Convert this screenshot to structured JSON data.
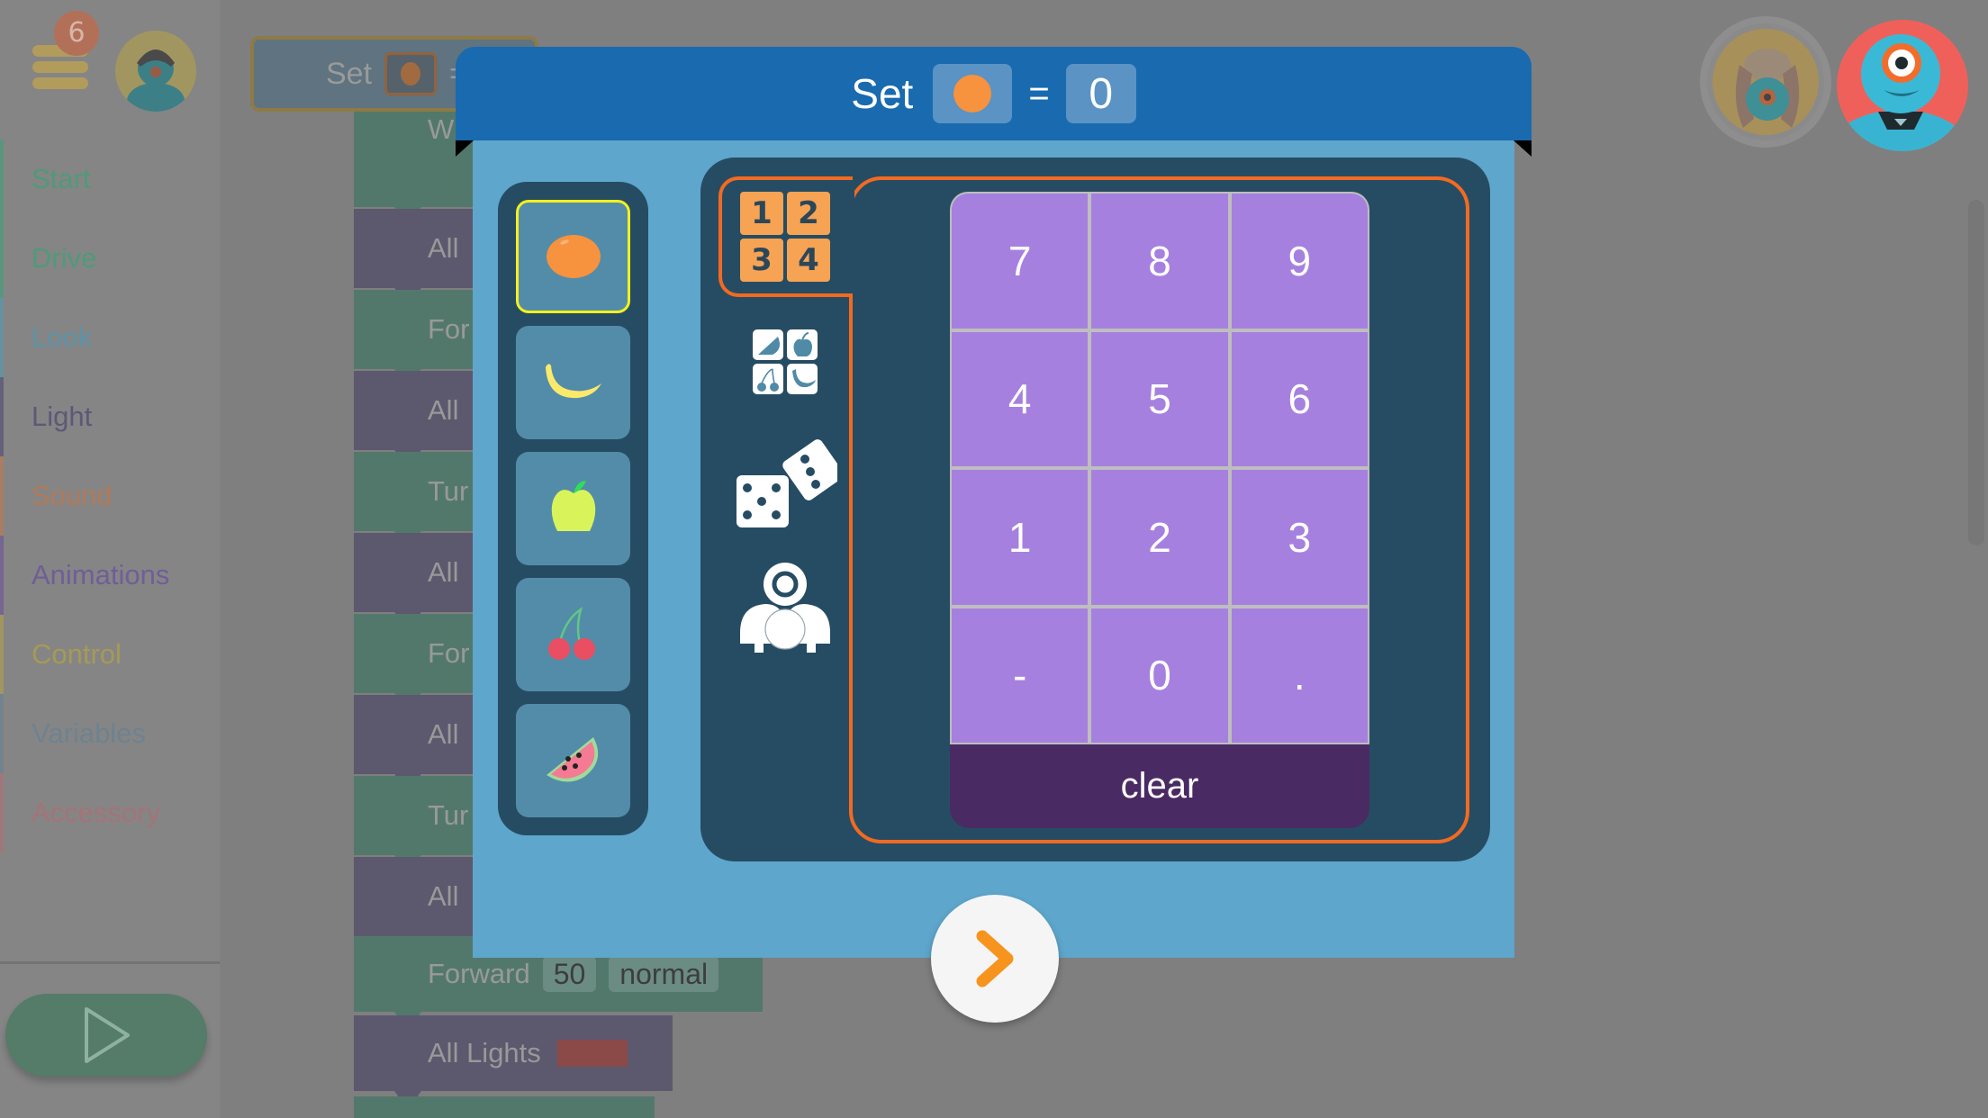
{
  "app": {
    "notification_count": "6",
    "sidebar": {
      "categories": [
        {
          "label": "Start",
          "color": "#4f9a7a"
        },
        {
          "label": "Drive",
          "color": "#4f9a7a"
        },
        {
          "label": "Look",
          "color": "#5d93a8"
        },
        {
          "label": "Light",
          "color": "#5d5877"
        },
        {
          "label": "Sound",
          "color": "#b07a5a"
        },
        {
          "label": "Animations",
          "color": "#705e96"
        },
        {
          "label": "Control",
          "color": "#a69a56"
        },
        {
          "label": "Variables",
          "color": "#6e8290"
        },
        {
          "label": "Accessory",
          "color": "#a57377"
        }
      ],
      "play_button": "play-icon"
    },
    "canvas": {
      "set_block": {
        "label": "Set",
        "variable_icon": "orange-icon",
        "eq": "="
      },
      "top_partial_label": "W",
      "blocks": [
        {
          "label": "All",
          "type": "light"
        },
        {
          "label": "For",
          "type": "drive"
        },
        {
          "label": "All",
          "type": "light"
        },
        {
          "label": "Tur",
          "type": "drive"
        },
        {
          "label": "All",
          "type": "light"
        },
        {
          "label": "For",
          "type": "drive"
        },
        {
          "label": "All",
          "type": "light"
        },
        {
          "label": "Tur",
          "type": "drive"
        },
        {
          "label": "All",
          "type": "light"
        }
      ],
      "forward_block": {
        "label": "Forward",
        "distance": "50",
        "speed": "normal"
      },
      "lights_block": {
        "label": "All Lights",
        "color": "#c0504d"
      }
    },
    "robots": [
      "dot-dog-avatar",
      "dash-robot-avatar"
    ]
  },
  "modal": {
    "header": {
      "label": "Set",
      "variable_icon": "orange-icon",
      "variable_color": "#f7923e",
      "eq": "=",
      "value": "0"
    },
    "variables": [
      {
        "name": "orange",
        "icon": "orange-icon",
        "selected": true
      },
      {
        "name": "banana",
        "icon": "banana-icon",
        "selected": false
      },
      {
        "name": "apple",
        "icon": "apple-icon",
        "selected": false
      },
      {
        "name": "cherry",
        "icon": "cherry-icon",
        "selected": false
      },
      {
        "name": "watermelon",
        "icon": "watermelon-icon",
        "selected": false
      }
    ],
    "modes": [
      {
        "name": "number",
        "icon": "number-grid-icon",
        "digits": [
          "1",
          "2",
          "3",
          "4"
        ],
        "active": true
      },
      {
        "name": "variable",
        "icon": "fruit-grid-icon",
        "active": false
      },
      {
        "name": "random",
        "icon": "dice-icon",
        "active": false
      },
      {
        "name": "sensor",
        "icon": "robot-sensor-icon",
        "active": false
      }
    ],
    "keypad": {
      "keys": [
        "7",
        "8",
        "9",
        "4",
        "5",
        "6",
        "1",
        "2",
        "3",
        "-",
        "0",
        "."
      ],
      "clear_label": "clear"
    },
    "next_button": "chevron-right-icon",
    "colors": {
      "header": "#196aaf",
      "body": "#5ea6cc",
      "panel": "#264c63",
      "accent": "#f26a22",
      "key": "#a680df",
      "clear": "#4a2a63",
      "selected_outline": "#f4f11c"
    }
  }
}
